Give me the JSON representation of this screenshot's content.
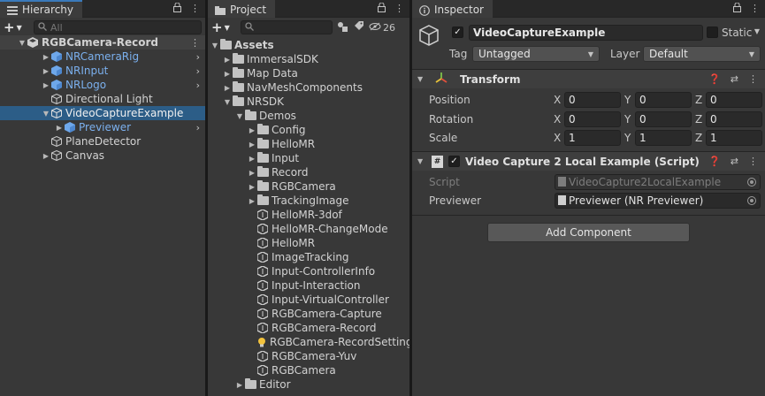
{
  "hierarchy": {
    "tab_label": "Hierarchy",
    "search_placeholder": "All",
    "scene": "RGBCamera-Record",
    "items": [
      {
        "label": "NRCameraRig"
      },
      {
        "label": "NRInput"
      },
      {
        "label": "NRLogo"
      },
      {
        "label": "Directional Light"
      },
      {
        "label": "VideoCaptureExample"
      },
      {
        "label": "Previewer"
      },
      {
        "label": "PlaneDetector"
      },
      {
        "label": "Canvas"
      }
    ]
  },
  "project": {
    "tab_label": "Project",
    "hidden_count": "26",
    "items": [
      {
        "label": "Assets"
      },
      {
        "label": "ImmersalSDK"
      },
      {
        "label": "Map Data"
      },
      {
        "label": "NavMeshComponents"
      },
      {
        "label": "NRSDK"
      },
      {
        "label": "Demos"
      },
      {
        "label": "Config"
      },
      {
        "label": "HelloMR"
      },
      {
        "label": "Input"
      },
      {
        "label": "Record"
      },
      {
        "label": "RGBCamera"
      },
      {
        "label": "TrackingImage"
      },
      {
        "label": "HelloMR-3dof"
      },
      {
        "label": "HelloMR-ChangeMode"
      },
      {
        "label": "HelloMR"
      },
      {
        "label": "ImageTracking"
      },
      {
        "label": "Input-ControllerInfo"
      },
      {
        "label": "Input-Interaction"
      },
      {
        "label": "Input-VirtualController"
      },
      {
        "label": "RGBCamera-Capture"
      },
      {
        "label": "RGBCamera-Record"
      },
      {
        "label": "RGBCamera-RecordSetting"
      },
      {
        "label": "RGBCamera-Yuv"
      },
      {
        "label": "RGBCamera"
      },
      {
        "label": "Editor"
      }
    ]
  },
  "inspector": {
    "tab_label": "Inspector",
    "object_name": "VideoCaptureExample",
    "static_label": "Static",
    "tag_label": "Tag",
    "tag_value": "Untagged",
    "layer_label": "Layer",
    "layer_value": "Default",
    "transform": {
      "title": "Transform",
      "position_label": "Position",
      "rotation_label": "Rotation",
      "scale_label": "Scale",
      "axis_x": "X",
      "axis_y": "Y",
      "axis_z": "Z",
      "position": [
        "0",
        "0",
        "0"
      ],
      "rotation": [
        "0",
        "0",
        "0"
      ],
      "scale": [
        "1",
        "1",
        "1"
      ]
    },
    "script_component": {
      "title": "Video Capture 2 Local Example (Script)",
      "script_label": "Script",
      "script_value": "VideoCapture2LocalExample",
      "previewer_label": "Previewer",
      "previewer_value": "Previewer (NR Previewer)"
    },
    "add_component_label": "Add Component"
  },
  "colors": {
    "selection": "#2c5d87",
    "prefab_blue": "#7bb0ee",
    "panel_bg": "#383838",
    "tab_accent": "#3a79bb"
  }
}
